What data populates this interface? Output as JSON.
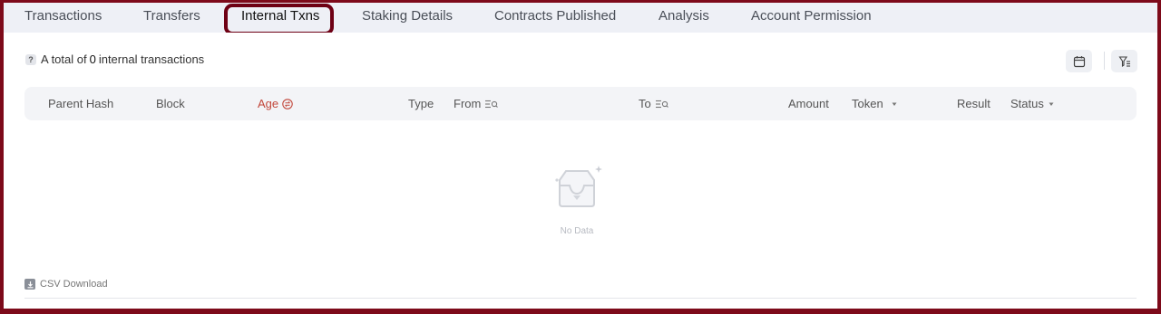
{
  "tabs": [
    {
      "label": "Transactions"
    },
    {
      "label": "Transfers"
    },
    {
      "label": "Internal Txns"
    },
    {
      "label": "Staking Details"
    },
    {
      "label": "Contracts Published"
    },
    {
      "label": "Analysis"
    },
    {
      "label": "Account Permission"
    }
  ],
  "active_tab": "Internal Txns",
  "summary": {
    "prefix": "A total of",
    "count": "0",
    "suffix": "internal transactions",
    "help_icon": "?"
  },
  "toolbar": {
    "calendar_icon": "calendar-icon",
    "filter_icon": "filter-icon"
  },
  "table": {
    "columns": [
      "Parent Hash",
      "Block",
      "Age",
      "Type",
      "From",
      "To",
      "Amount",
      "Token",
      "Result",
      "Status"
    ],
    "rows": []
  },
  "empty_state": {
    "label": "No Data",
    "icon": "empty-inbox-icon"
  },
  "csv_download": {
    "label": "CSV Download",
    "icon": "download-icon"
  },
  "colors": {
    "accent": "#c2473b",
    "frame": "#7d0a1a",
    "highlight": "#6e0014"
  }
}
